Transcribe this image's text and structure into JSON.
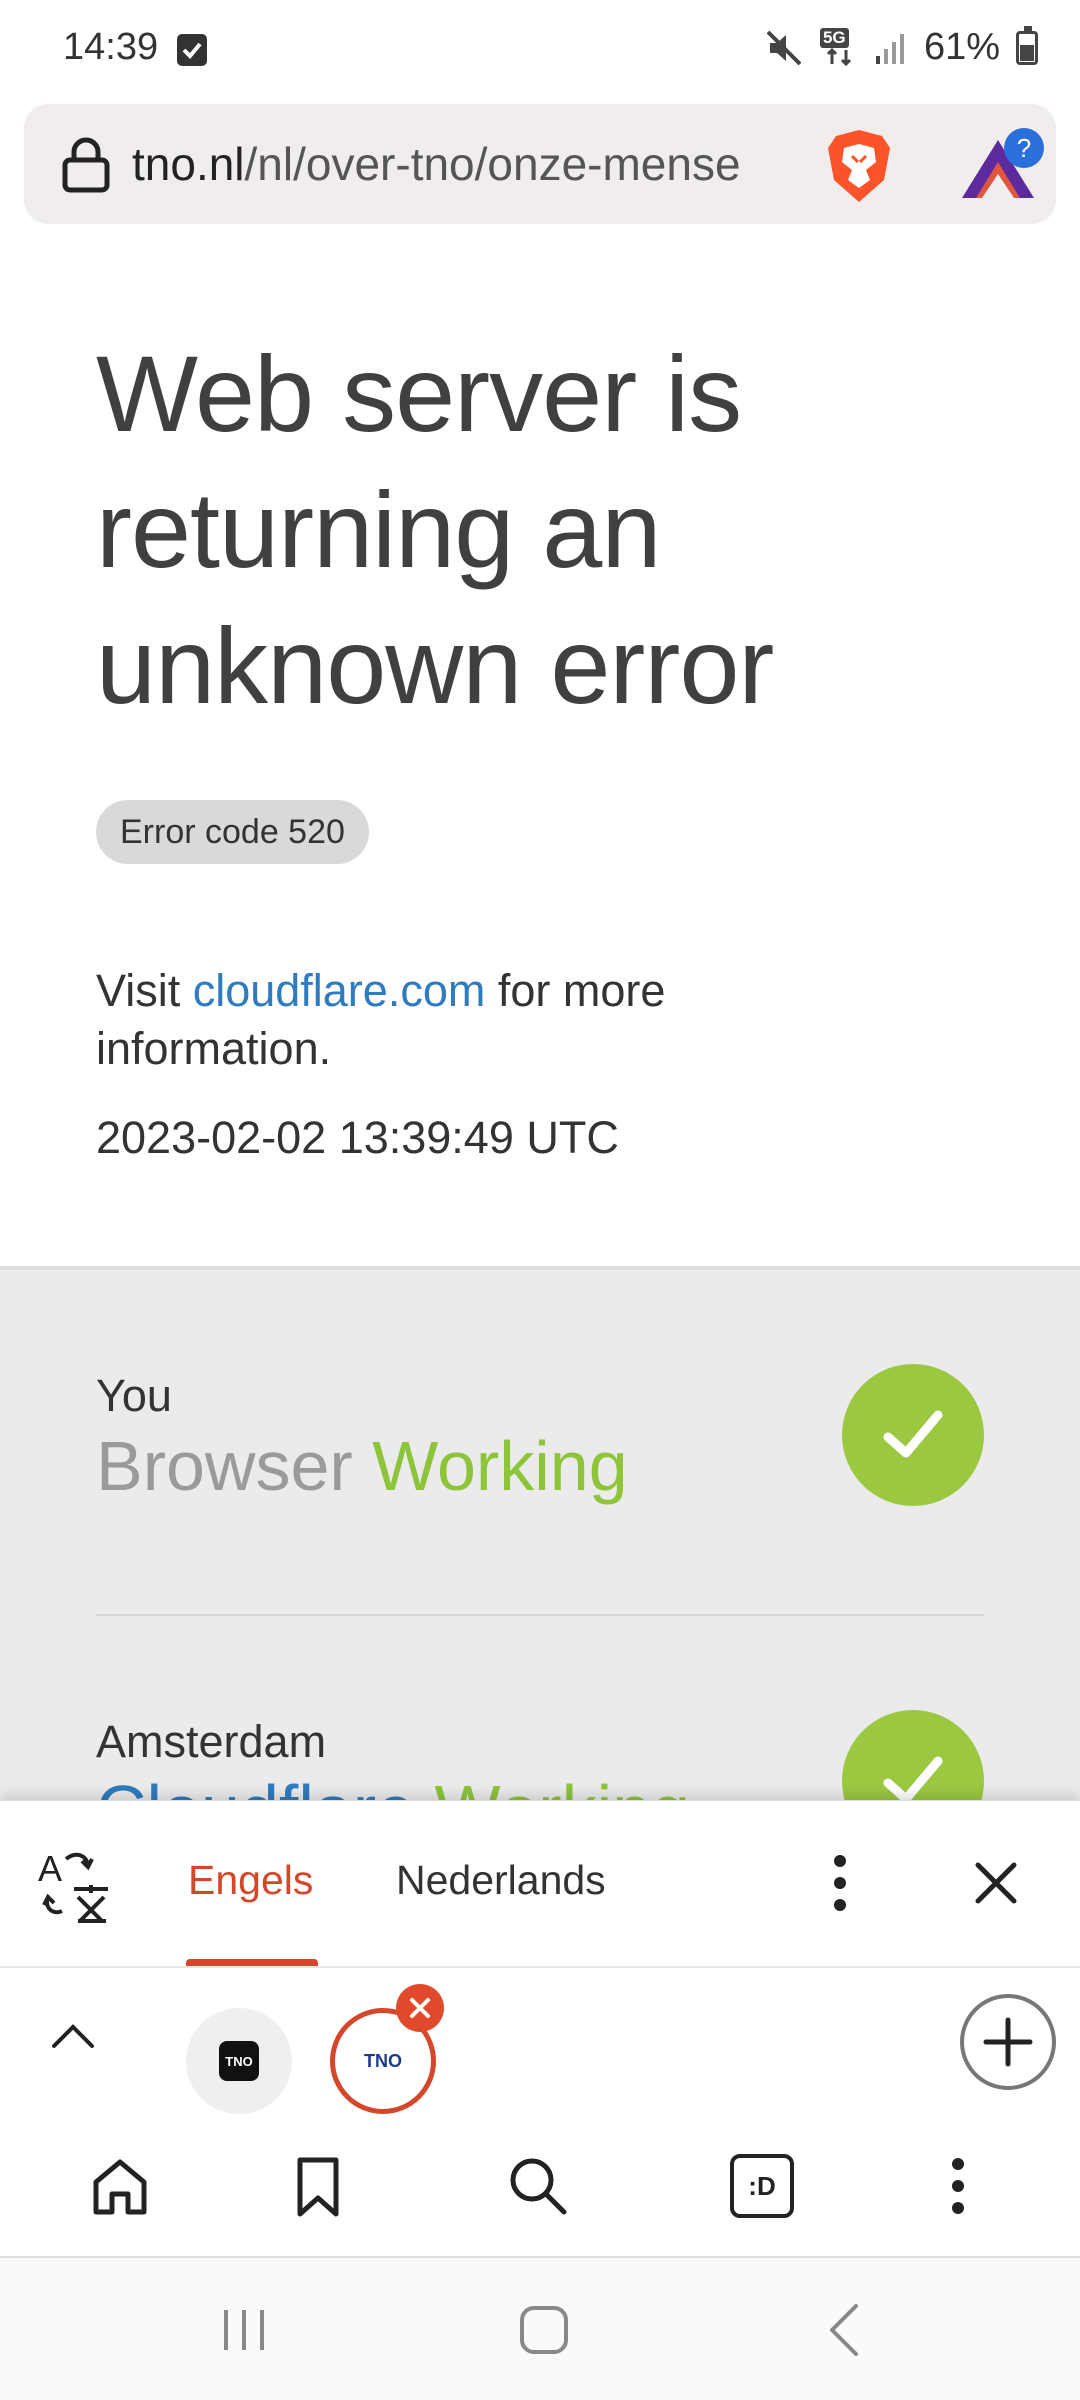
{
  "status_bar": {
    "time": "14:39",
    "network": "5G",
    "battery": "61%"
  },
  "address_bar": {
    "url_domain": "tno.nl",
    "url_path": "/nl/over-tno/onze-mense"
  },
  "page": {
    "title": "Web server is returning an unknown error",
    "error_code": "Error code 520",
    "visit_prefix": "Visit ",
    "visit_link": "cloudflare.com",
    "visit_suffix": " for more information.",
    "timestamp": "2023-02-02 13:39:49 UTC"
  },
  "status_panel": {
    "nodes": [
      {
        "label": "You",
        "kind": "Browser",
        "state": "Working"
      },
      {
        "label": "Amsterdam",
        "kind": "Cloudflare",
        "state": "Working"
      }
    ]
  },
  "translate_bar": {
    "source_lang": "Engels",
    "target_lang": "Nederlands"
  },
  "tab_strip": {
    "tabs": [
      {
        "logo_text": "TNO"
      },
      {
        "logo_text": "TNO"
      }
    ]
  },
  "toolbar": {
    "tabs_label": ":D"
  },
  "colors": {
    "brand_accent": "#d4472a",
    "link": "#2f7bbf",
    "ok_green": "#9bc840"
  }
}
